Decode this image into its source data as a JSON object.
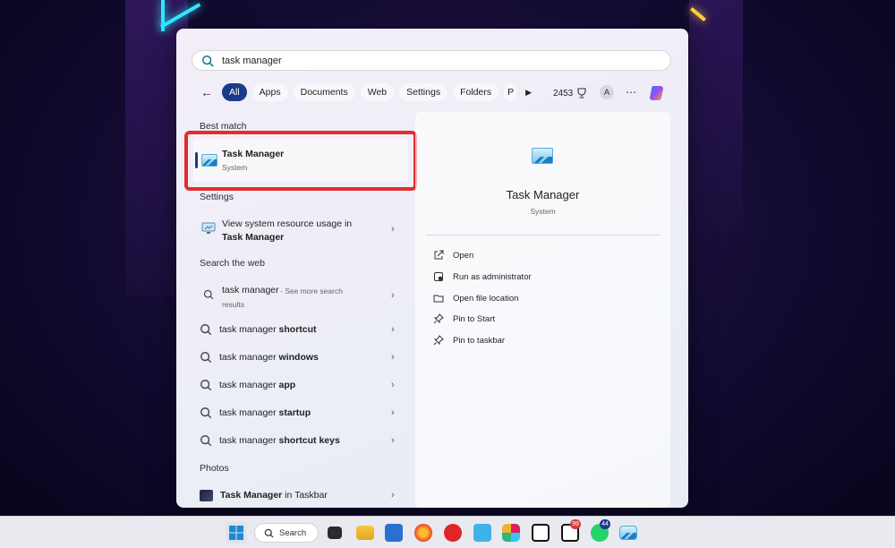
{
  "search": {
    "query": "task manager"
  },
  "filters": {
    "items": [
      "All",
      "Apps",
      "Documents",
      "Web",
      "Settings",
      "Folders",
      "P"
    ],
    "active": "All",
    "points": "2453",
    "avatar_letter": "A"
  },
  "left": {
    "best_match_title": "Best match",
    "best_match": {
      "title": "Task Manager",
      "subtitle": "System"
    },
    "settings_title": "Settings",
    "settings_item": {
      "line1": "View system resource usage in",
      "line2": "Task Manager"
    },
    "web_title": "Search the web",
    "web_first": {
      "query": "task manager",
      "hint": " - See more search",
      "hint2": "results"
    },
    "web_items": [
      {
        "prefix": "task manager ",
        "bold": "shortcut"
      },
      {
        "prefix": "task manager ",
        "bold": "windows"
      },
      {
        "prefix": "task manager ",
        "bold": "app"
      },
      {
        "prefix": "task manager ",
        "bold": "startup"
      },
      {
        "prefix": "task manager ",
        "bold": "shortcut keys"
      }
    ],
    "photos_title": "Photos",
    "photos_item": {
      "bold": "Task Manager",
      "suffix": " in Taskbar"
    }
  },
  "right": {
    "title": "Task Manager",
    "subtitle": "System",
    "actions": [
      "Open",
      "Run as administrator",
      "Open file location",
      "Pin to Start",
      "Pin to taskbar"
    ]
  },
  "taskbar": {
    "search_label": "Search",
    "badges": {
      "notion": "99",
      "whatsapp": "44"
    }
  }
}
